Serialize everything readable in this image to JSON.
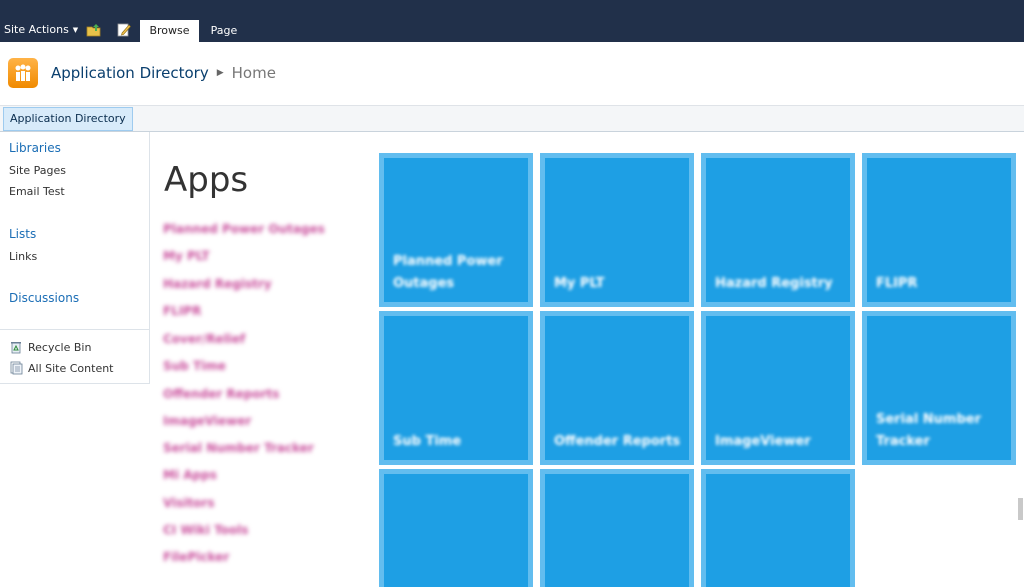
{
  "ribbon": {
    "site_actions": "Site Actions",
    "tabs": [
      "Browse",
      "Page"
    ]
  },
  "header": {
    "site_title": "Application Directory",
    "page_title": "Home"
  },
  "topnav": {
    "items": [
      "Application Directory"
    ]
  },
  "quicklaunch": {
    "headings": [
      "Libraries",
      "Lists",
      "Discussions"
    ],
    "libraries": [
      "Site Pages",
      "Email Test"
    ],
    "lists": [
      "Links"
    ],
    "special": [
      "Recycle Bin",
      "All Site Content"
    ]
  },
  "main": {
    "heading": "Apps",
    "app_links": [
      "Planned Power Outages",
      "My PLT",
      "Hazard Registry",
      "FLIPR",
      "Cover/Relief",
      "Sub Time",
      "Offender Reports",
      "ImageViewer",
      "Serial Number Tracker",
      "Mi Apps",
      "Visitors",
      "CI Wiki Tools",
      "FilePicker"
    ],
    "tiles": [
      "Planned Power Outages",
      "My PLT",
      "Hazard Registry",
      "FLIPR",
      "Sub Time",
      "Offender Reports",
      "ImageViewer",
      "Serial Number Tracker",
      "",
      "",
      ""
    ]
  },
  "colors": {
    "ribbon_bg": "#21304a",
    "tile_fill": "#1e9fe4",
    "tile_border": "#62bdef",
    "link_blue": "#1a6db5",
    "app_link_pink": "#c94e9c"
  }
}
